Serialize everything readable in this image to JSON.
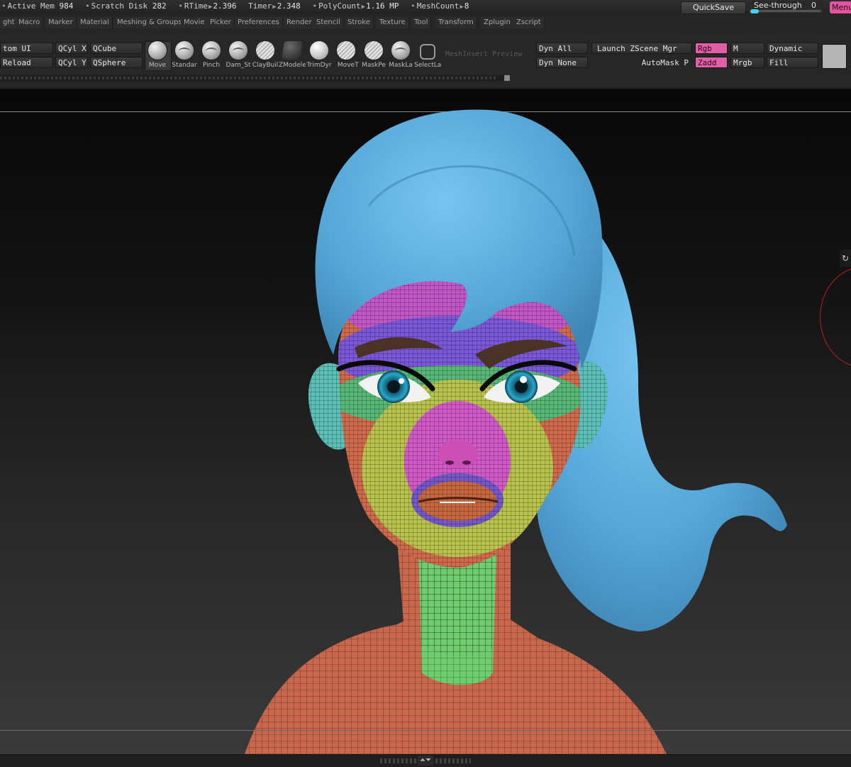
{
  "status": {
    "stats": [
      {
        "label": "Active Mem",
        "value": "984"
      },
      {
        "label": "Scratch Disk",
        "value": "282"
      },
      {
        "label": "RTime",
        "value": "2.396"
      },
      {
        "label": "Timer",
        "value": "2.348"
      },
      {
        "label": "PolyCount",
        "value": "1.16 MP"
      },
      {
        "label": "MeshCount",
        "value": "8"
      }
    ],
    "quicksave": "QuickSave",
    "see_through_label": "See-through",
    "see_through_value": "0",
    "menus_button": "Menu"
  },
  "menubar": [
    "ght",
    "Macro",
    "Marker",
    "Material",
    "Meshing & Groups",
    "Movie",
    "Picker",
    "Preferences",
    "Render",
    "Stencil",
    "Stroke",
    "Texture",
    "Tool",
    "Transform",
    "Zplugin",
    "Zscript"
  ],
  "shelf": {
    "left_buttons": {
      "custom_ui": "tom UI",
      "reload": "Reload",
      "qcyl_x": "QCyl X",
      "qcyl_y": "QCyl Y",
      "qcube": "QCube",
      "qsphere": "QSphere"
    },
    "brushes": [
      "Move",
      "Standar",
      "Pinch",
      "Dam_St",
      "ClayBuil",
      "ZModele",
      "TrimDyr",
      "Move",
      "T",
      "MaskPe",
      "MaskLa",
      "SelectLa"
    ],
    "meshinsert_preview": "MeshInsert Preview",
    "right_buttons": {
      "dyn_all": "Dyn All",
      "dyn_none": "Dyn None",
      "launch_zscene": "Launch ZScene Mgr",
      "automask": "AutoMask P",
      "rgb": "Rgb",
      "zadd": "Zadd",
      "m": "M",
      "mrgb": "Mrgb",
      "dynamic": "Dynamic",
      "fill": "Fill"
    }
  },
  "viewport": {
    "rotate_icon": "↻",
    "model": "stylized female head sculpt with blue ponytail and polygroup wireframe"
  },
  "bottombar": {
    "arrow": "⏶⏷"
  }
}
